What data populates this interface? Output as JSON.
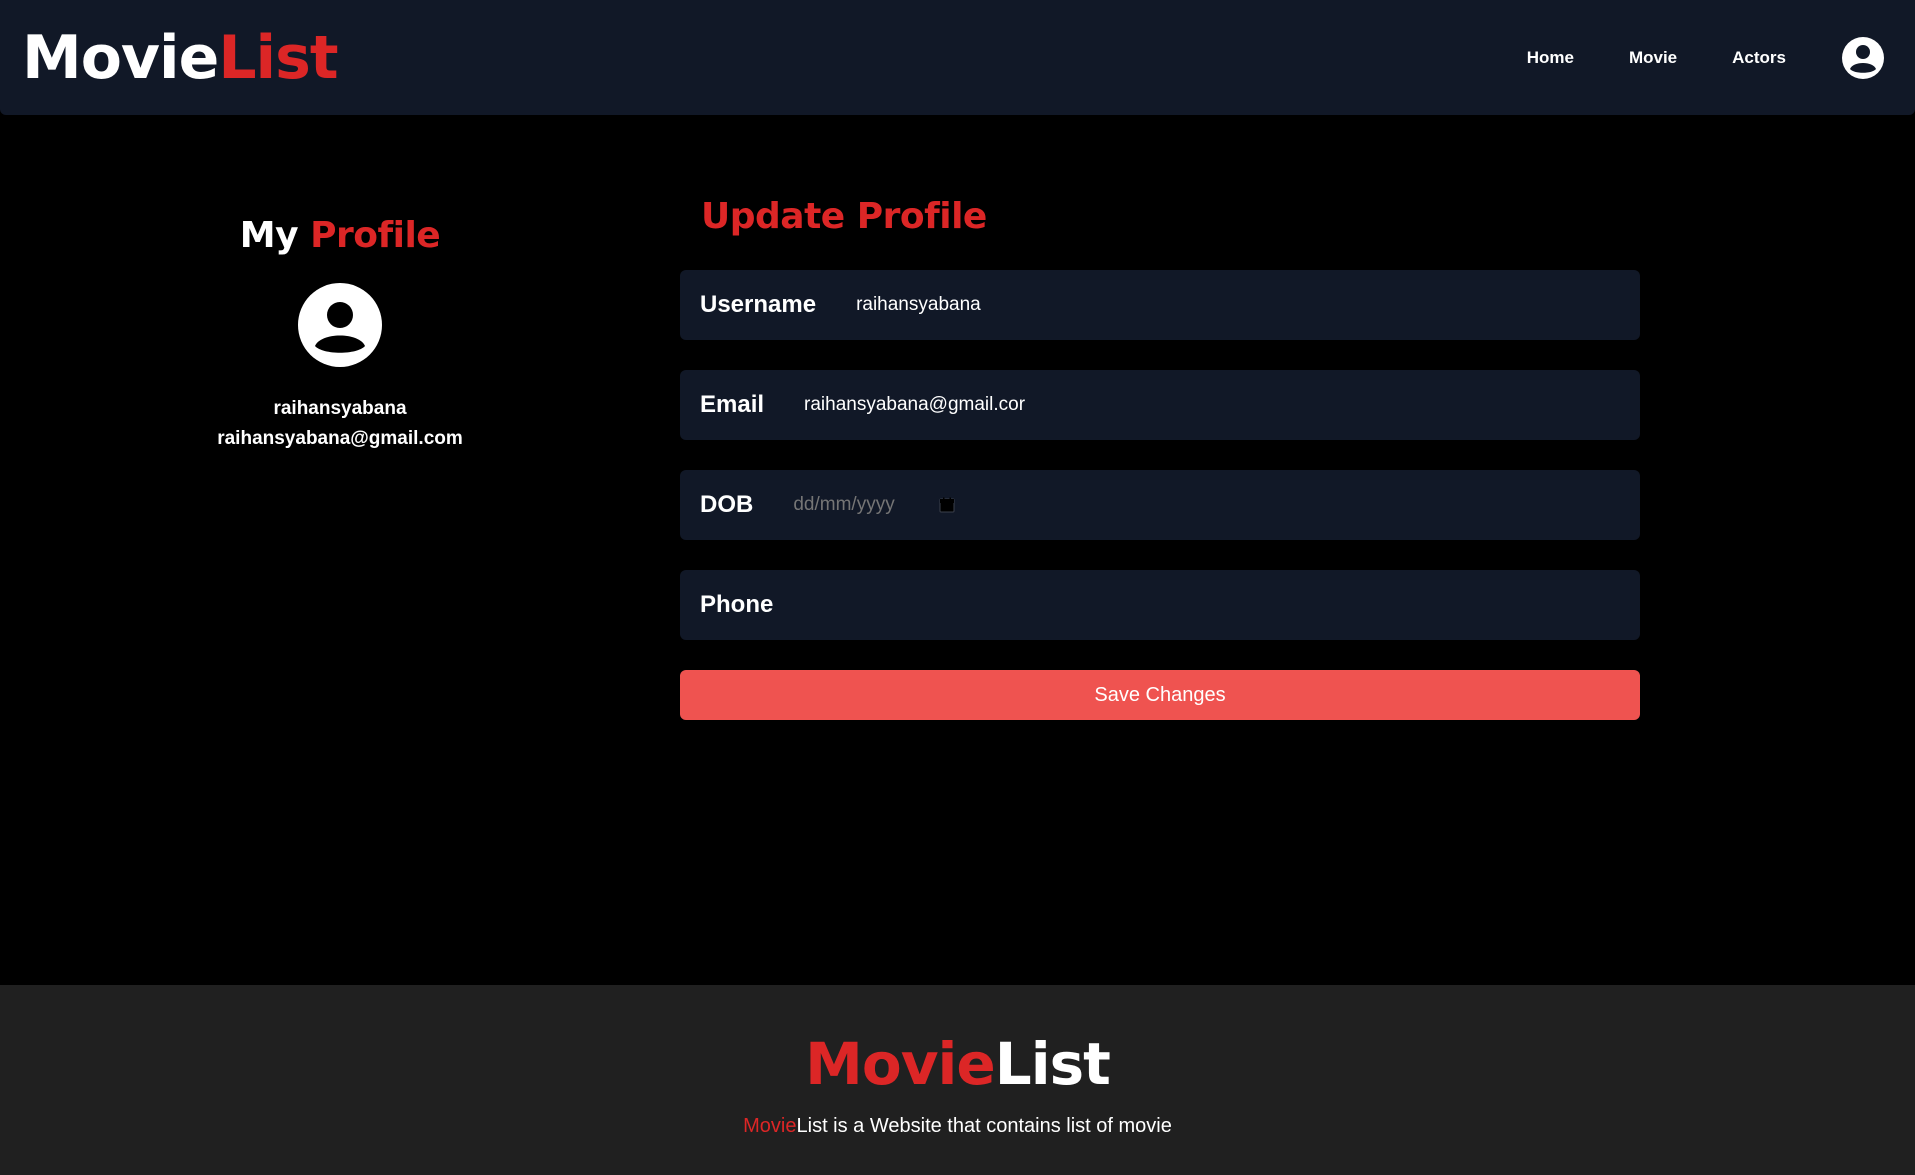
{
  "navbar": {
    "logo_part1": "Movie",
    "logo_part2": "List",
    "links": [
      {
        "label": "Home"
      },
      {
        "label": "Movie"
      },
      {
        "label": "Actors"
      }
    ],
    "avatar_icon": "user-circle-icon"
  },
  "profile": {
    "title_part1": "My",
    "title_part2": "Profile",
    "avatar_icon": "user-circle-icon",
    "username": "raihansyabana",
    "email": "raihansyabana@gmail.com"
  },
  "update": {
    "title": "Update Profile",
    "fields": {
      "username": {
        "label": "Username",
        "value": "raihansyabana"
      },
      "email": {
        "label": "Email",
        "value": "raihansyabana@gmail.cor"
      },
      "dob": {
        "label": "DOB",
        "placeholder": "dd/mm/yyyy",
        "icon": "calendar-icon"
      },
      "phone": {
        "label": "Phone",
        "value": ""
      }
    },
    "save_label": "Save Changes"
  },
  "footer": {
    "logo_part1": "Movie",
    "logo_part2": "List",
    "tagline_highlight": "Movie",
    "tagline_rest": "List is a Website that contains list of movie"
  },
  "colors": {
    "accent_red": "#dc2626",
    "button_red": "#ef5350",
    "navbar_bg": "#111827",
    "field_bg": "#111827",
    "footer_bg": "#202020",
    "page_bg": "#000000"
  }
}
